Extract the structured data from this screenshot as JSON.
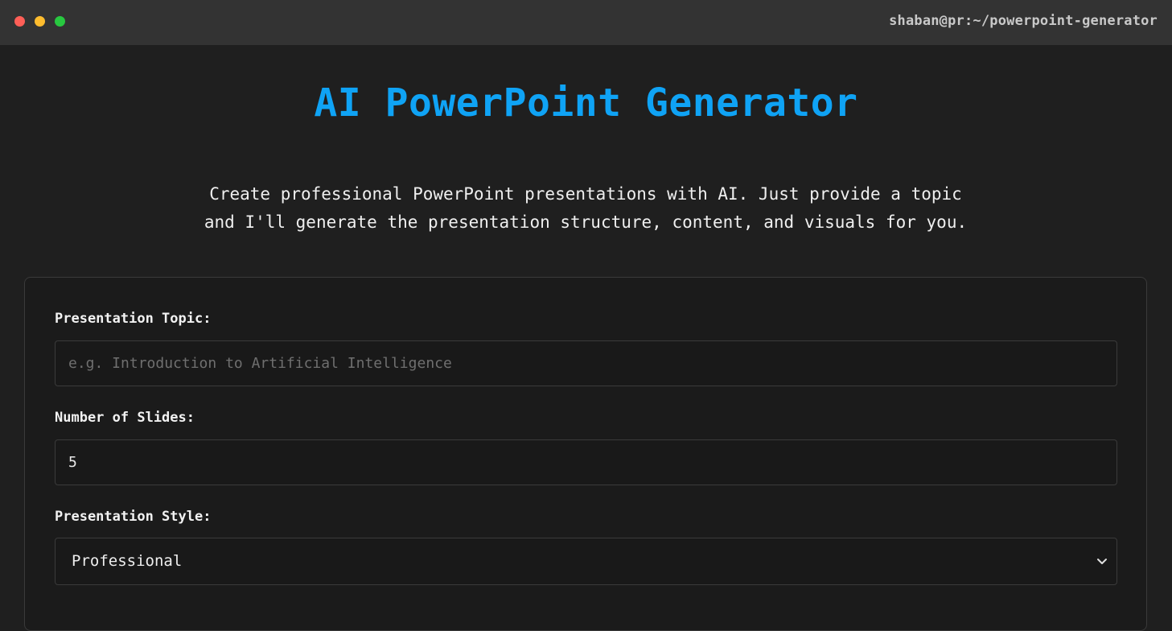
{
  "window": {
    "path": "shaban@pr:~/powerpoint-generator"
  },
  "header": {
    "title": "AI PowerPoint Generator",
    "subtitle_line1": "Create professional PowerPoint presentations with AI. Just provide a topic",
    "subtitle_line2": "and I'll generate the presentation structure, content, and visuals for you."
  },
  "form": {
    "topic_label": "Presentation Topic:",
    "topic_placeholder": "e.g. Introduction to Artificial Intelligence",
    "topic_value": "",
    "slides_label": "Number of Slides:",
    "slides_value": "5",
    "style_label": "Presentation Style:",
    "style_value": "Professional"
  },
  "colors": {
    "accent": "#0fa3f5",
    "background": "#1f1f1f",
    "titlebar": "#333333"
  },
  "icons": {
    "select_chevron": "chevron-down-icon"
  }
}
